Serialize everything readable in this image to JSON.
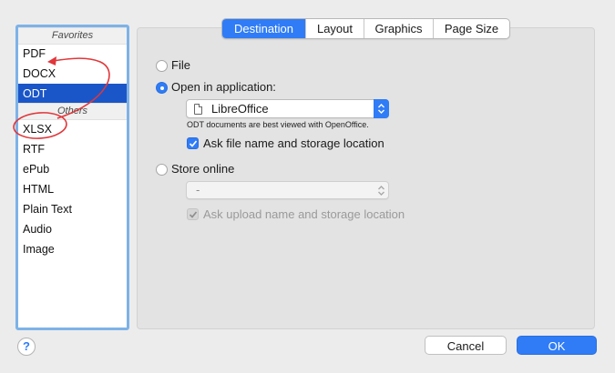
{
  "sidebar": {
    "favorites_header": "Favorites",
    "favorites": [
      "PDF",
      "DOCX",
      "ODT"
    ],
    "selected": "ODT",
    "others_header": "Others",
    "others": [
      "XLSX",
      "RTF",
      "ePub",
      "HTML",
      "Plain Text",
      "Audio",
      "Image"
    ]
  },
  "tabs": [
    {
      "label": "Destination",
      "active": true
    },
    {
      "label": "Layout",
      "active": false
    },
    {
      "label": "Graphics",
      "active": false
    },
    {
      "label": "Page Size",
      "active": false
    }
  ],
  "destination": {
    "file_label": "File",
    "open_app_label": "Open in application:",
    "app_value": "LibreOffice",
    "app_note": "ODT documents are best viewed with OpenOffice.",
    "ask_file_label": "Ask file name and storage location",
    "ask_file_checked": true,
    "store_online_label": "Store online",
    "online_value": "-",
    "ask_upload_label": "Ask upload name and storage location",
    "ask_upload_checked": true
  },
  "footer": {
    "help_label": "?",
    "cancel_label": "Cancel",
    "ok_label": "OK"
  },
  "colors": {
    "accent": "#2f7cf6",
    "selection": "#1b56c8",
    "annotation": "#e0373a"
  }
}
